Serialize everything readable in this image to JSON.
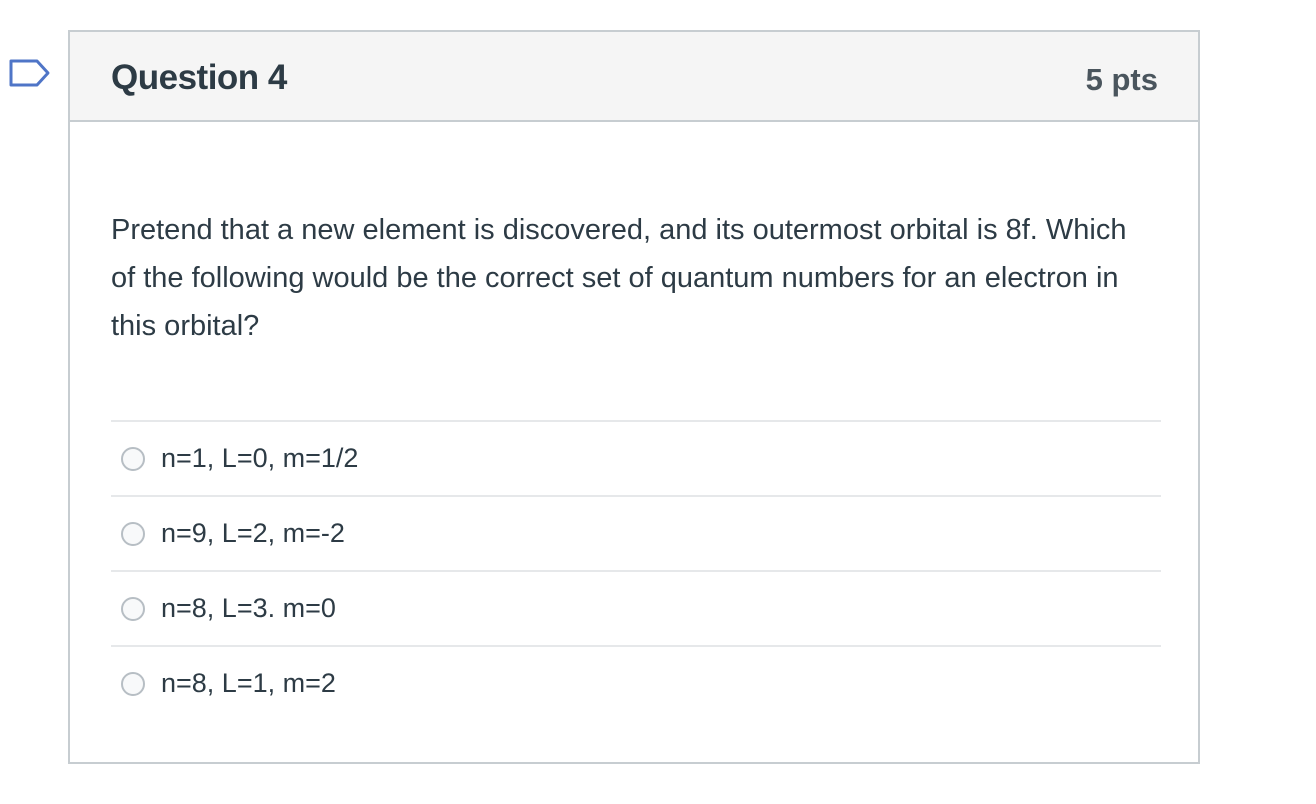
{
  "icons": {
    "flag": "question-flag-icon",
    "radio": "radio-button-icon"
  },
  "colors": {
    "header_background": "#f5f5f5",
    "border": "#c7cdd1",
    "text": "#2d3b45",
    "flag_outline": "#4f75c7"
  },
  "question": {
    "title": "Question 4",
    "points": "5 pts",
    "text": "Pretend that a new element is discovered, and its outermost orbital is 8f. Which of the following would be the correct set of quantum numbers for an electron in this orbital?"
  },
  "answers": [
    {
      "label": "n=1, L=0, m=1/2",
      "selected": false
    },
    {
      "label": "n=9, L=2, m=-2",
      "selected": false
    },
    {
      "label": "n=8, L=3. m=0",
      "selected": false
    },
    {
      "label": "n=8, L=1, m=2",
      "selected": false
    }
  ]
}
